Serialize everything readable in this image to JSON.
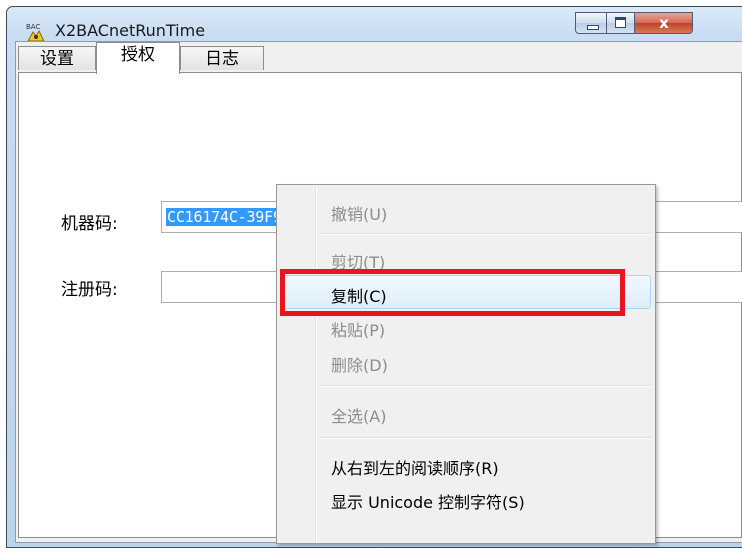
{
  "window": {
    "icon_text": "BAC",
    "title": "X2BACnetRunTime",
    "close_glyph": "x"
  },
  "tabs": [
    {
      "label": "设置"
    },
    {
      "label": "授权"
    },
    {
      "label": "日志"
    }
  ],
  "form": {
    "machine_code_label": "机器码:",
    "machine_code_value": "CC16174C-39F9-4021-1A95-CD0B2EFEC105",
    "registration_code_label": "注册码:",
    "registration_code_value": ""
  },
  "context_menu": {
    "items": [
      {
        "label": "撤销(U)",
        "enabled": false
      },
      {
        "label": "剪切(T)",
        "enabled": false
      },
      {
        "label": "复制(C)",
        "enabled": true
      },
      {
        "label": "粘贴(P)",
        "enabled": false
      },
      {
        "label": "删除(D)",
        "enabled": false
      },
      {
        "label": "全选(A)",
        "enabled": false
      },
      {
        "label": "从右到左的阅读顺序(R)",
        "enabled": true
      },
      {
        "label": "显示 Unicode 控制字符(S)",
        "enabled": true
      }
    ],
    "highlighted_item": "复制(C)",
    "annotation_color": "#e8151b"
  }
}
